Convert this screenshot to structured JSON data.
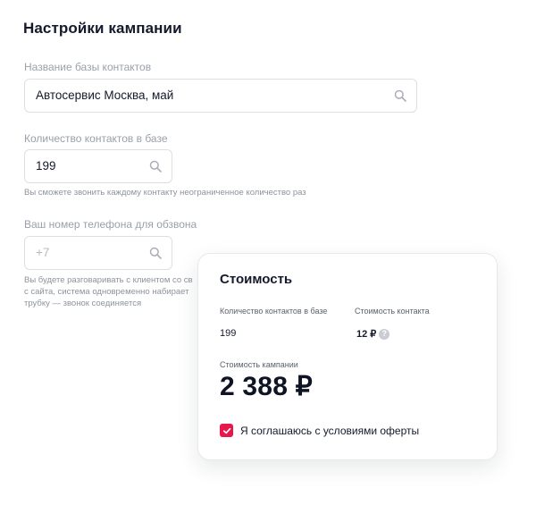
{
  "page": {
    "title": "Настройки кампании"
  },
  "form": {
    "base_name": {
      "label": "Название базы контактов",
      "value": "Автосервис Москва, май"
    },
    "contacts_count": {
      "label": "Количество контактов в базе",
      "value": "199",
      "hint": "Вы сможете звонить каждому контакту неограниченное количество раз"
    },
    "phone": {
      "label": "Ваш номер телефона для обзвона",
      "placeholder": "+7",
      "hint_lines": [
        "Вы будете разговаривать с клиентом со св",
        "с сайта, система одновременно набирает",
        "трубку — звонок соединяется"
      ]
    }
  },
  "cost": {
    "title": "Стоимость",
    "contacts_label": "Количество контактов в базе",
    "contacts_value": "199",
    "contact_price_label": "Стоимость контакта",
    "contact_price_value": "12 ₽",
    "help_symbol": "?",
    "total_label": "Стоимость кампании",
    "total_value": "2 388 ₽",
    "agree_text": "Я соглашаюсь с условиями оферты",
    "agree_checked": true
  },
  "colors": {
    "accent": "#e8164b",
    "text_primary": "#141a2b",
    "text_muted": "#9aa0aa",
    "border": "#dcdfe5"
  },
  "icons": {
    "search": "search-icon",
    "help": "help-icon",
    "check": "checkmark-icon"
  }
}
